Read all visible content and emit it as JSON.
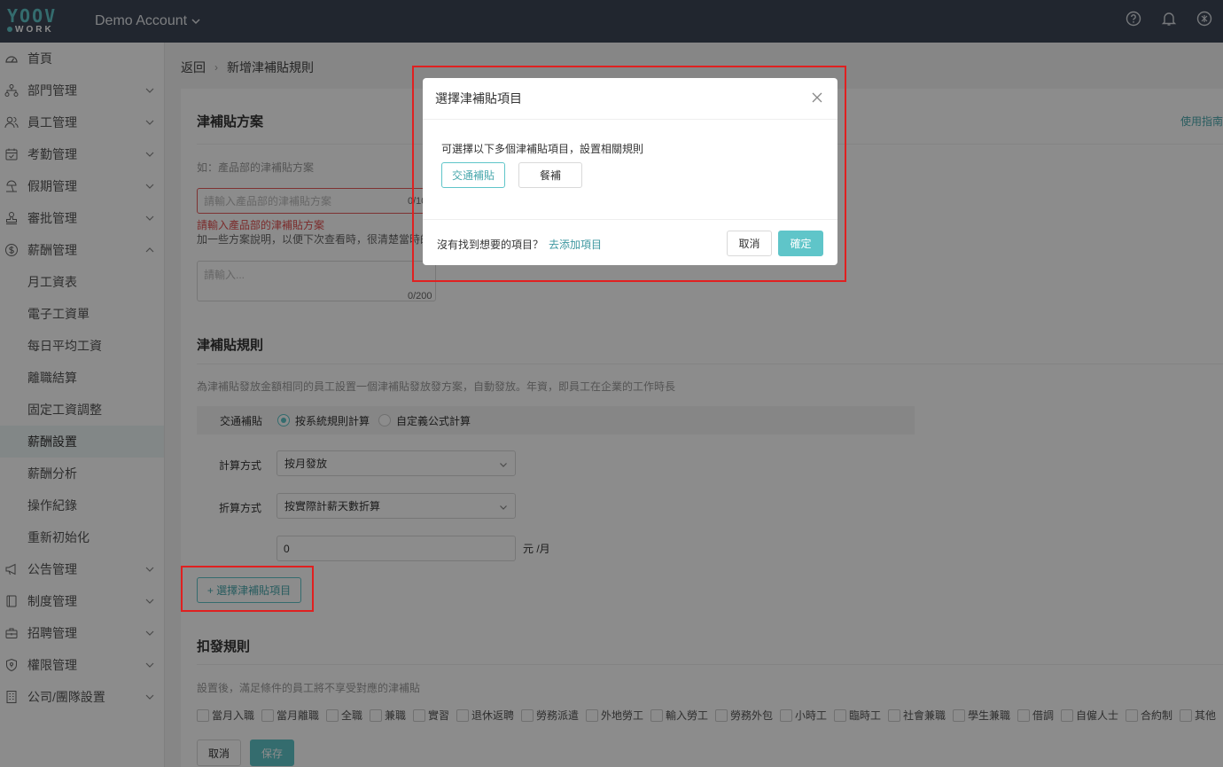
{
  "header": {
    "logo_top": "YOOV",
    "logo_bottom": "WORK",
    "account": "Demo Account",
    "icons": [
      "help-icon",
      "bell-icon",
      "settings-badge-icon"
    ]
  },
  "sidebar": {
    "items": [
      {
        "label": "首頁",
        "icon": "dashboard-icon",
        "expandable": false
      },
      {
        "label": "部門管理",
        "icon": "org-icon",
        "expandable": true
      },
      {
        "label": "員工管理",
        "icon": "users-icon",
        "expandable": true
      },
      {
        "label": "考勤管理",
        "icon": "calendar-icon",
        "expandable": true
      },
      {
        "label": "假期管理",
        "icon": "beach-icon",
        "expandable": true
      },
      {
        "label": "審批管理",
        "icon": "stamp-icon",
        "expandable": true
      },
      {
        "label": "薪酬管理",
        "icon": "dollar-icon",
        "expandable": true,
        "expanded": true
      }
    ],
    "sub_items": [
      "月工資表",
      "電子工資單",
      "每日平均工資",
      "離職結算",
      "固定工資調整",
      "薪酬設置",
      "薪酬分析",
      "操作紀錄",
      "重新初始化"
    ],
    "active_sub": "薪酬設置",
    "bottom_items": [
      {
        "label": "公告管理",
        "icon": "megaphone-icon"
      },
      {
        "label": "制度管理",
        "icon": "book-icon"
      },
      {
        "label": "招聘管理",
        "icon": "briefcase-icon"
      },
      {
        "label": "權限管理",
        "icon": "shield-icon"
      },
      {
        "label": "公司/團隊設置",
        "icon": "building-icon"
      }
    ]
  },
  "breadcrumb": {
    "back": "返回",
    "sep": "›",
    "current": "新增津補貼規則"
  },
  "plan": {
    "title": "津補貼方案",
    "guide": "使用指南",
    "hint": "如：產品部的津補貼方案",
    "name_placeholder": "請輸入產品部的津補貼方案",
    "name_counter": "0/10",
    "error": "請輸入產品部的津補貼方案",
    "desc_hint": "加一些方案說明，以便下次查看時，很清楚當時的津補",
    "desc_placeholder": "請輸入...",
    "desc_counter": "0/200"
  },
  "rules": {
    "title": "津補貼規則",
    "desc": "為津補貼發放金額相同的員工設置一個津補貼發放發方案，自動發放。年資，即員工在企業的工作時長",
    "item_name": "交通補貼",
    "radio_1": "按系統規則計算",
    "radio_2": "自定義公式計算",
    "calc_label": "計算方式",
    "calc_value": "按月發放",
    "discount_label": "折算方式",
    "discount_value": "按實際計薪天數折算",
    "amount_value": "0",
    "amount_unit": "元 /月",
    "add_button": "+ 選擇津補貼項目"
  },
  "deduct": {
    "title": "扣發規則",
    "desc": "設置後，滿足條件的員工將不享受對應的津補貼",
    "options": [
      "當月入職",
      "當月離職",
      "全職",
      "兼職",
      "實習",
      "退休返聘",
      "勞務派遣",
      "外地勞工",
      "輸入勞工",
      "勞務外包",
      "小時工",
      "臨時工",
      "社會兼職",
      "學生兼職",
      "借調",
      "自僱人士",
      "合約制",
      "其他"
    ]
  },
  "footer": {
    "cancel": "取消",
    "save": "保存"
  },
  "modal": {
    "title": "選擇津補貼項目",
    "tip": "可選擇以下多個津補貼項目，設置相關規則",
    "chip_selected": "交通補貼",
    "chip_other": "餐補",
    "footer_question": "沒有找到想要的項目？",
    "footer_link": "去添加項目",
    "cancel": "取消",
    "confirm": "確定"
  },
  "colors": {
    "topbar": "#3c4656",
    "accent": "#5fc5c9",
    "error": "#e05050",
    "highlight": "#e02020"
  }
}
